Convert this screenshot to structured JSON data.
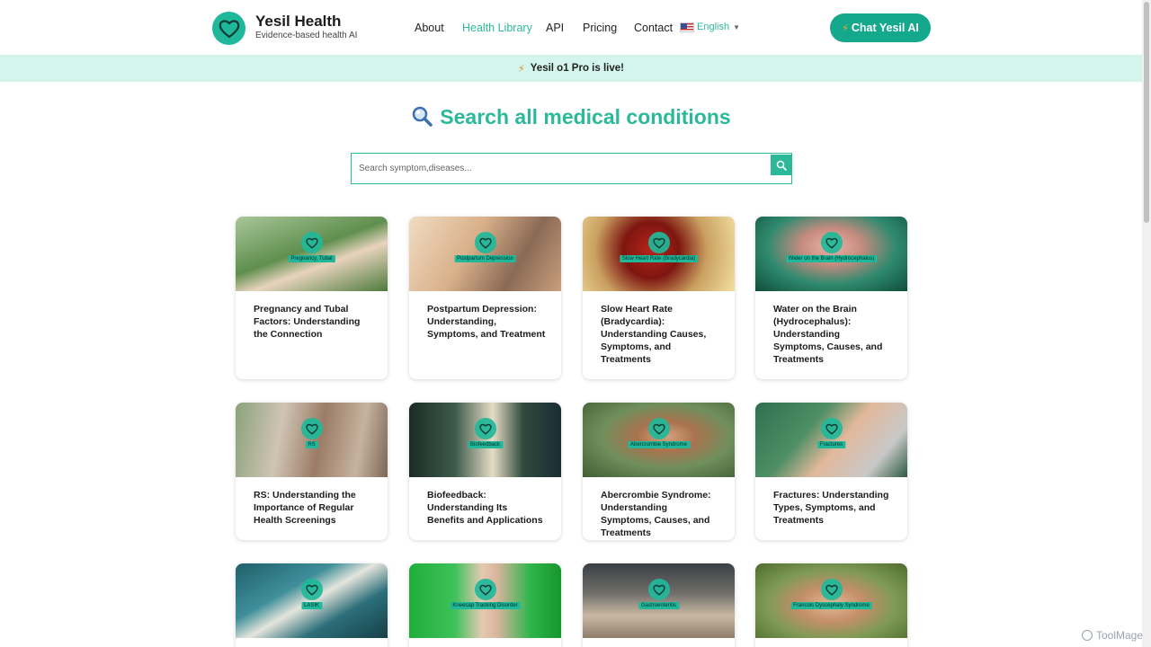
{
  "header": {
    "brand_name": "Yesil Health",
    "brand_tagline": "Evidence-based health AI",
    "logo_icon": "heart-icon",
    "nav": [
      {
        "label": "About",
        "active": false
      },
      {
        "label": "Health Library",
        "active": true
      },
      {
        "label": "API",
        "active": false
      },
      {
        "label": "Pricing",
        "active": false
      },
      {
        "label": "Contact",
        "active": false
      }
    ],
    "language": {
      "label": "English",
      "flag": "us-flag-icon"
    },
    "chat_button": {
      "label": "Chat Yesil AI",
      "icon": "bolt-icon"
    }
  },
  "banner": {
    "text": "Yesil o1 Pro is live!",
    "icon": "bolt-icon"
  },
  "search": {
    "heading": "Search all medical conditions",
    "heading_icon": "magnifier-icon",
    "placeholder": "Search symptom,diseases...",
    "button_icon": "search-icon"
  },
  "cards": [
    {
      "label": "Pregnancy, Tubal",
      "title": "Pregnancy and Tubal Factors: Understanding the Connection"
    },
    {
      "label": "Postpartum Depression",
      "title": "Postpartum Depression: Understanding, Symptoms, and Treatment"
    },
    {
      "label": "Slow Heart Rate (Bradycardia)",
      "title": "Slow Heart Rate (Bradycardia): Understanding Causes, Symptoms, and Treatments"
    },
    {
      "label": "Water on the Brain (Hydrocephalus)",
      "title": "Water on the Brain (Hydrocephalus): Understanding Symptoms, Causes, and Treatments"
    },
    {
      "label": "RS",
      "title": "RS: Understanding the Importance of Regular Health Screenings"
    },
    {
      "label": "Biofeedback",
      "title": "Biofeedback: Understanding Its Benefits and Applications"
    },
    {
      "label": "Abercrombie Syndrome",
      "title": "Abercrombie Syndrome: Understanding Symptoms, Causes, and Treatments"
    },
    {
      "label": "Fractures",
      "title": "Fractures: Understanding Types, Symptoms, and Treatments"
    },
    {
      "label": "LASIK",
      "title": ""
    },
    {
      "label": "Kneecap Tracking Disorder",
      "title": ""
    },
    {
      "label": "Gastroenteritis",
      "title": ""
    },
    {
      "label": "Francois Dyscephaly Syndrome",
      "title": ""
    }
  ],
  "watermark": {
    "text": "ToolMage"
  },
  "colors": {
    "accent": "#2cb99a",
    "button": "#14a88c",
    "banner_bg": "#d4f5ec"
  }
}
